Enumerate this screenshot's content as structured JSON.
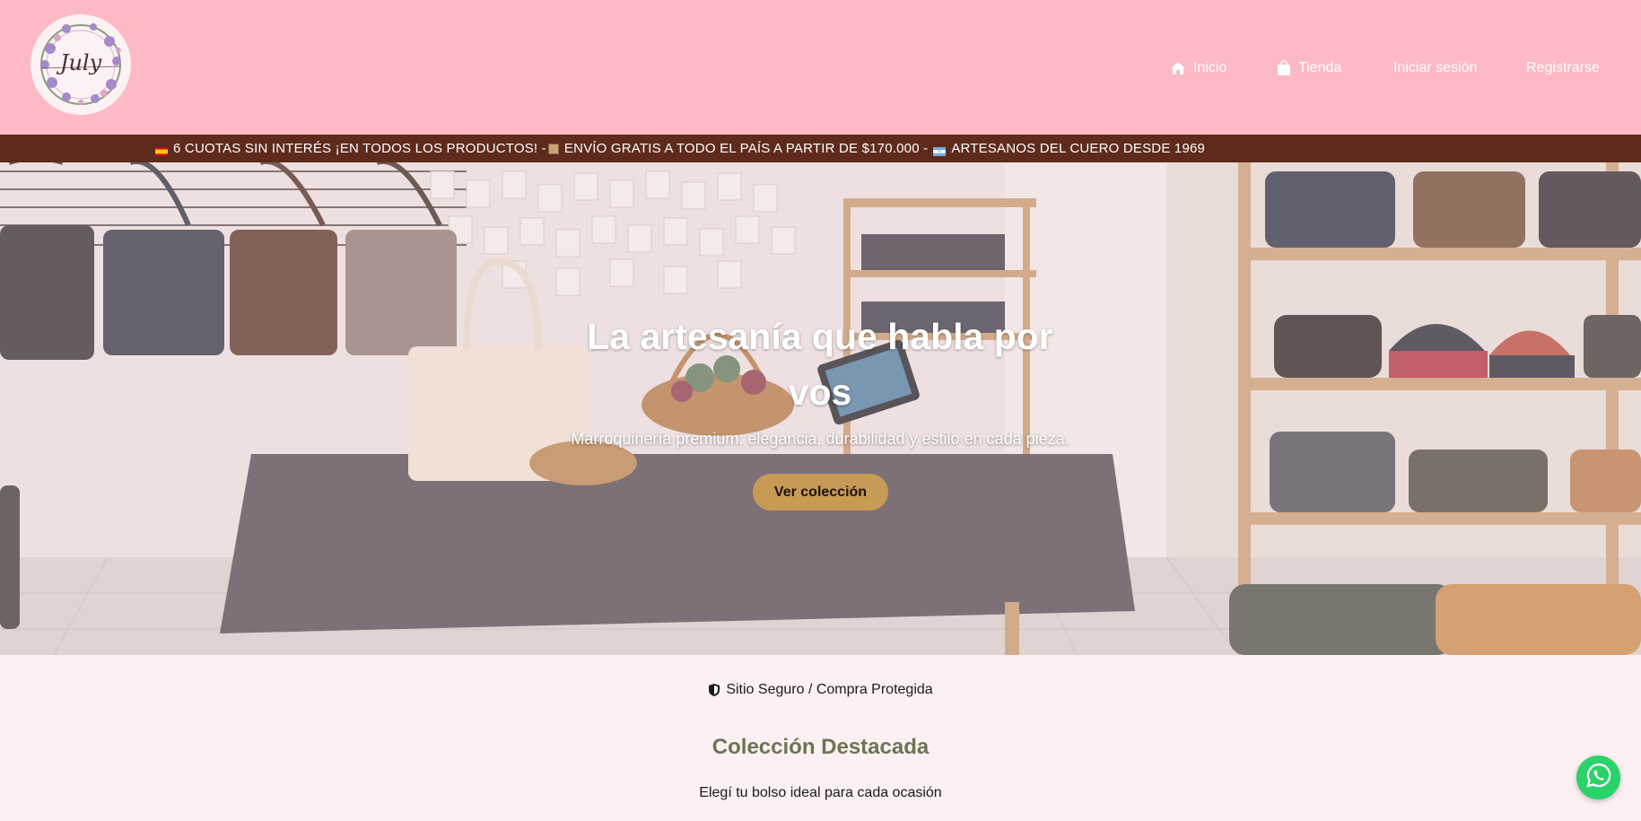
{
  "brand": {
    "logo_alt": "July",
    "logo_text": "July"
  },
  "nav": {
    "home": "Inicio",
    "shop": "Tienda",
    "login": "Iniciar sesión",
    "register": "Registrarse"
  },
  "announcement": {
    "part1": "6 CUOTAS SIN INTERÉS ¡EN TODOS LOS PRODUCTOS! -",
    "part2": "ENVÍO GRATIS A TODO EL PAÍS A PARTIR DE $170.000 -",
    "part3": "ARTESANOS DEL CUERO DESDE 1969"
  },
  "hero": {
    "title": "La artesanía que habla por vos",
    "subtitle": "Marroquinería premium: elegancia, durabilidad y estilo en cada pieza.",
    "cta": "Ver colección"
  },
  "trust": {
    "label": "Sitio Seguro / Compra Protegida"
  },
  "featured": {
    "title": "Colección Destacada",
    "subtitle": "Elegí tu bolso ideal para cada ocasión"
  },
  "icons": {
    "home": "home-icon",
    "shop": "shopping-bag-icon",
    "shield": "shield-icon",
    "whatsapp": "whatsapp-icon"
  },
  "colors": {
    "header_bg": "#fdbac4",
    "announcement_bg": "#5d2a1c",
    "cta_bg": "#c79a56",
    "section_title": "#6d7453",
    "whatsapp": "#2ad26a"
  }
}
